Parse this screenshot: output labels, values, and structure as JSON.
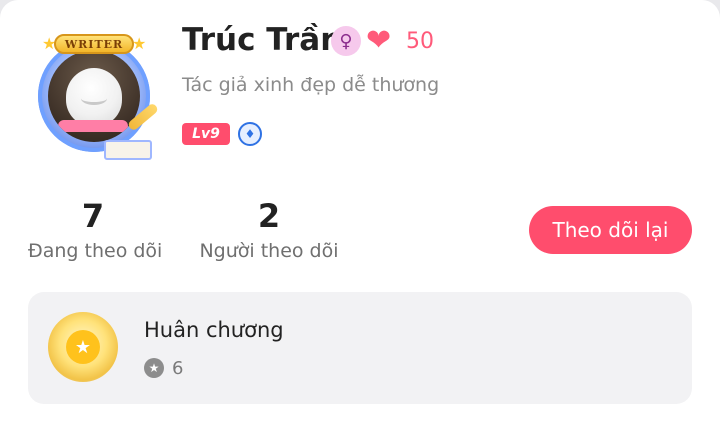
{
  "profile": {
    "avatar_badge_text": "WRITER",
    "name": "Trúc Trần",
    "gender_icon": "female-symbol-icon",
    "heart_icon": "hearts-icon",
    "heart_count": "50",
    "bio": "Tác giả xinh đẹp dễ thương",
    "level_badge": "Lv9",
    "verified_icon": "shield-badge-icon",
    "accent_color": "#ff4d6d"
  },
  "stats": {
    "following_count": "7",
    "following_label": "Đang theo dõi",
    "followers_count": "2",
    "followers_label": "Người theo dõi"
  },
  "actions": {
    "follow_back_label": "Theo dõi lại"
  },
  "medals": {
    "title": "Huân chương",
    "count": "6",
    "icon": "medal-icon"
  }
}
